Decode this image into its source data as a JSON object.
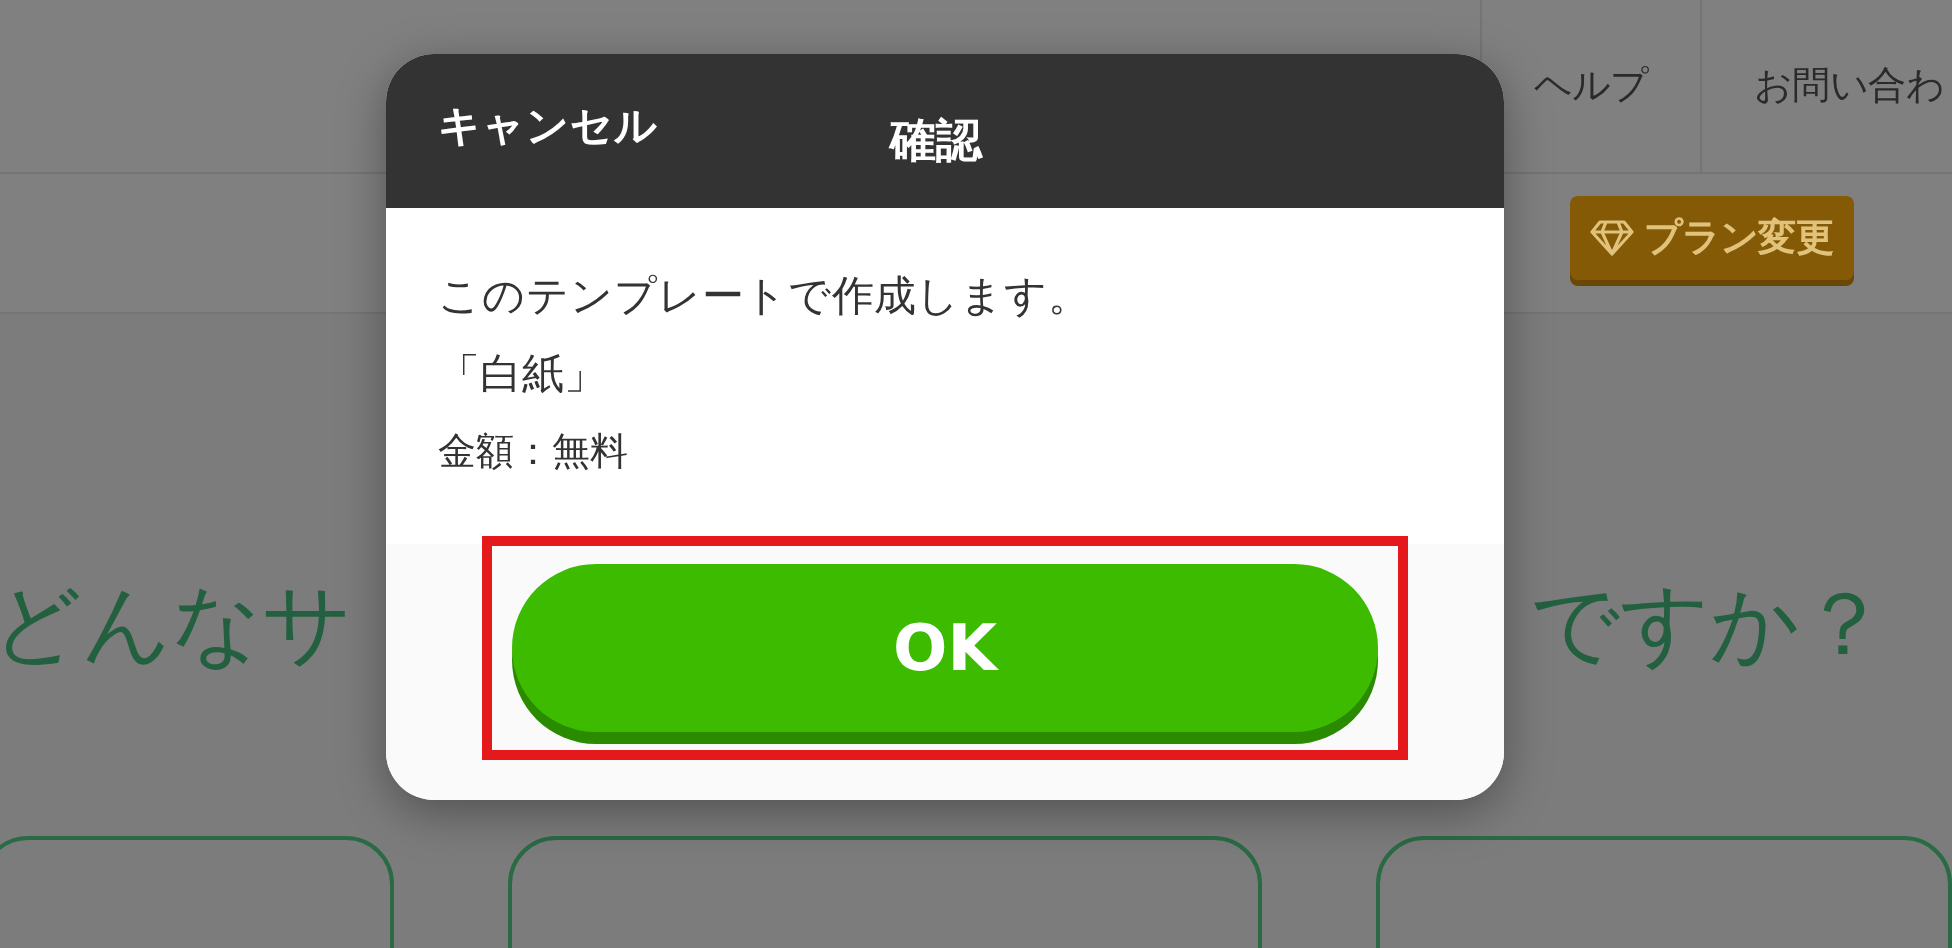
{
  "nav": {
    "items": [
      {
        "label": "ヘルプ"
      },
      {
        "label": "お問い合わ"
      }
    ]
  },
  "plan_button": {
    "label": "プラン変更"
  },
  "headline": {
    "left": "どんなサ",
    "right": "ですか？"
  },
  "dialog": {
    "cancel": "キャンセル",
    "title": "確認",
    "lines": [
      "このテンプレートで作成します。",
      "「白紙」",
      "金額：無料"
    ],
    "ok_button": {
      "label": "OK",
      "highlighted": true
    }
  }
}
